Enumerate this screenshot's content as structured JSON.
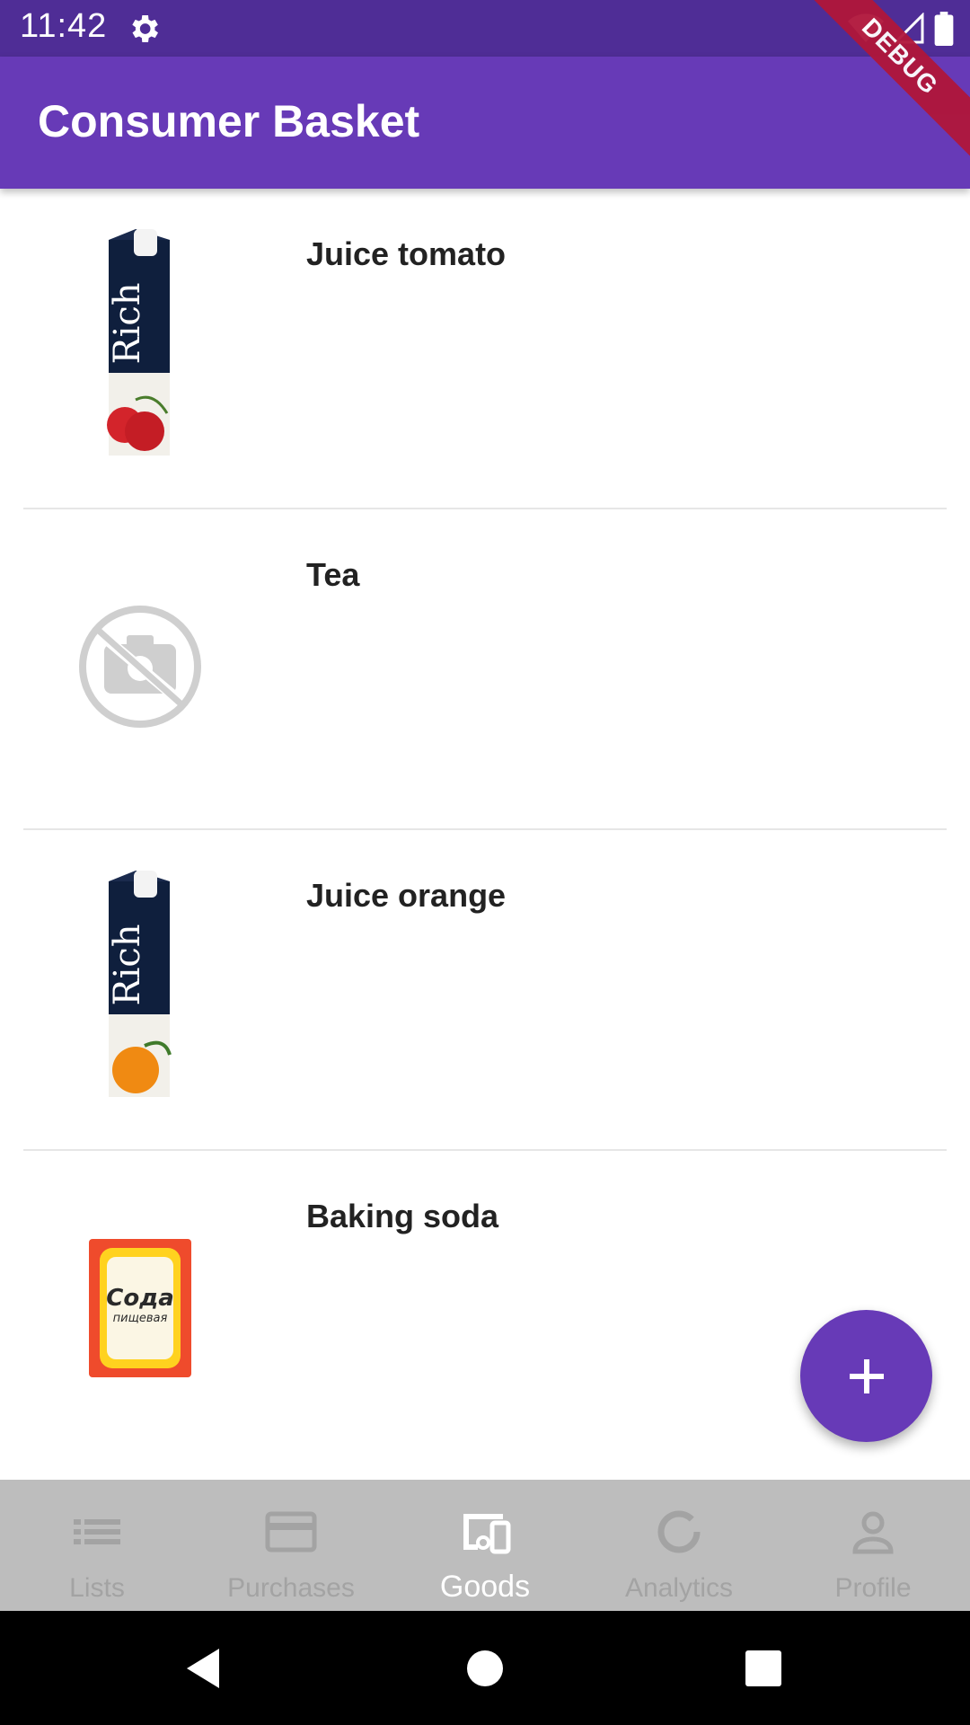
{
  "status_bar": {
    "time": "11:42"
  },
  "debug_banner": "DEBUG",
  "app_bar": {
    "title": "Consumer Basket"
  },
  "goods": [
    {
      "name": "Juice tomato",
      "image": "rich-tomato-juice-carton"
    },
    {
      "name": "Tea",
      "image": "no-photo-icon"
    },
    {
      "name": "Juice orange",
      "image": "rich-orange-juice-carton"
    },
    {
      "name": "Baking soda",
      "image": "soda-box"
    }
  ],
  "fab": {
    "icon": "plus-icon"
  },
  "bottom_nav": {
    "active": "Goods",
    "items": [
      {
        "label": "Lists",
        "icon": "list-icon"
      },
      {
        "label": "Purchases",
        "icon": "card-icon"
      },
      {
        "label": "Goods",
        "icon": "devices-icon"
      },
      {
        "label": "Analytics",
        "icon": "donut-icon"
      },
      {
        "label": "Profile",
        "icon": "person-icon"
      }
    ]
  },
  "colors": {
    "primary": "#673ab7",
    "status_bar": "#4f2d96",
    "nav_bg": "#bdbdbd",
    "debug": "#b0163a"
  }
}
